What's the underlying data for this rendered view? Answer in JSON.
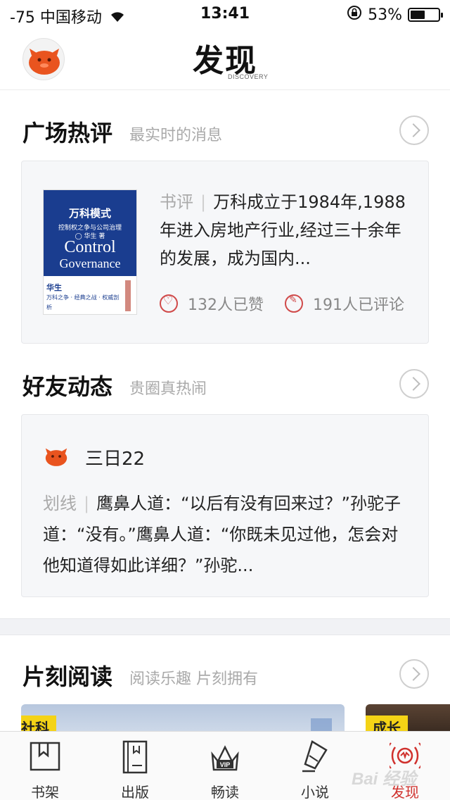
{
  "status_bar": {
    "carrier": "-75 中国移动",
    "time": "13:41",
    "battery": "53%",
    "battery_level": 0.53
  },
  "header": {
    "title": "发现",
    "title_en": "DISCOVERY"
  },
  "sections": {
    "hot_reviews": {
      "title": "广场热评",
      "subtitle": "最实时的消息",
      "card": {
        "book": {
          "title": "万科模式",
          "subtitle": "控制权之争与公司治理",
          "author": "◯ 华生 著",
          "en_line1": "Control",
          "en_line2": "Governance",
          "brand": "华生",
          "tagline": "万科之争 · 经典之战 · 权威剖析"
        },
        "tag": "书评",
        "separator": "|",
        "text": "万科成立于1984年,1988年进入房地产行业,经过三十余年的发展，成为国内...",
        "likes": "132人已赞",
        "comments": "191人已评论"
      }
    },
    "friend_feed": {
      "title": "好友动态",
      "subtitle": "贵圈真热闹",
      "card": {
        "user": "三日22",
        "tag": "划线",
        "separator": "|",
        "text": "鹰鼻人道：“以后有没有回来过？”孙驼子道：“没有。”鹰鼻人道：“你既未见过他，怎会对他知道得如此详细？”孙驼..."
      }
    },
    "moment_reading": {
      "title": "片刻阅读",
      "subtitle": "阅读乐趣 片刻拥有",
      "cards": [
        {
          "label": "社科"
        },
        {
          "label": "成长"
        }
      ]
    }
  },
  "tabbar": {
    "items": [
      {
        "label": "书架",
        "icon": "bookshelf-icon"
      },
      {
        "label": "出版",
        "icon": "book-icon"
      },
      {
        "label": "畅读",
        "icon": "vip-crown-icon"
      },
      {
        "label": "小说",
        "icon": "pen-icon"
      },
      {
        "label": "发现",
        "icon": "discover-icon"
      }
    ],
    "active": 4,
    "active_color": "#d0312d"
  },
  "watermark": "Bai 经验"
}
